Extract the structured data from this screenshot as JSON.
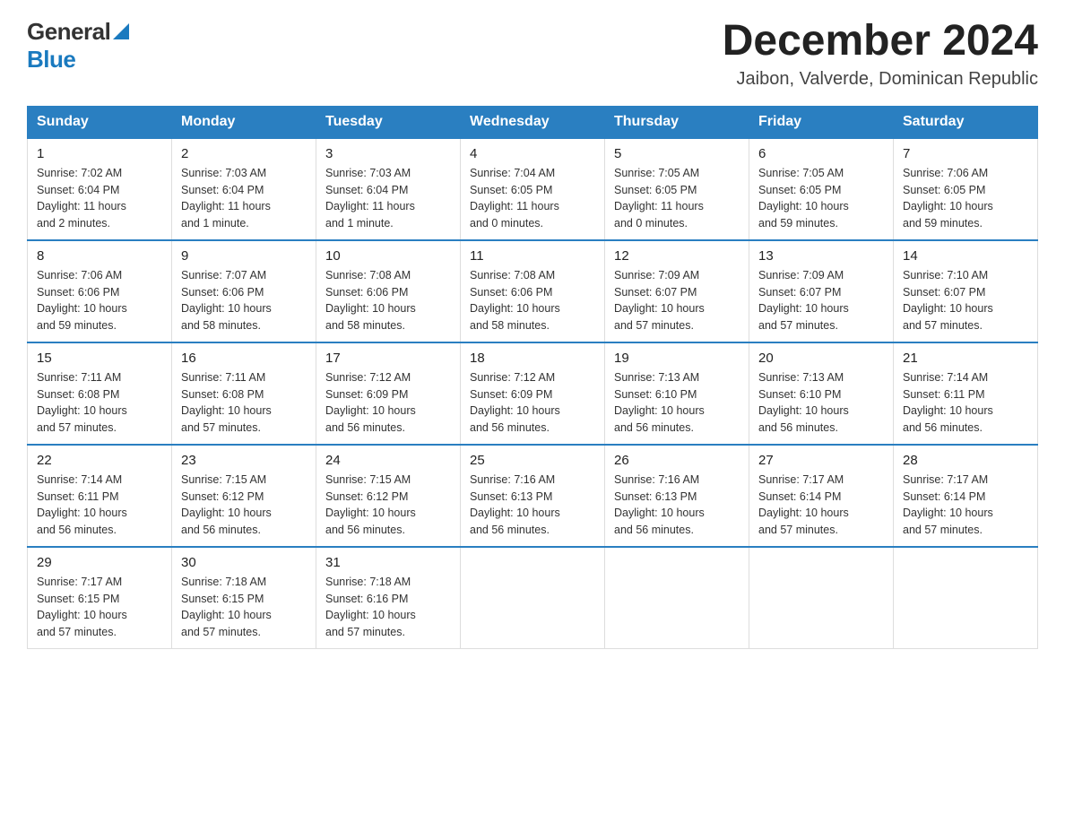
{
  "header": {
    "logo_general": "General",
    "logo_blue": "Blue",
    "title": "December 2024",
    "subtitle": "Jaibon, Valverde, Dominican Republic"
  },
  "days_of_week": [
    "Sunday",
    "Monday",
    "Tuesday",
    "Wednesday",
    "Thursday",
    "Friday",
    "Saturday"
  ],
  "weeks": [
    [
      {
        "num": "1",
        "sunrise": "7:02 AM",
        "sunset": "6:04 PM",
        "daylight": "11 hours and 2 minutes."
      },
      {
        "num": "2",
        "sunrise": "7:03 AM",
        "sunset": "6:04 PM",
        "daylight": "11 hours and 1 minute."
      },
      {
        "num": "3",
        "sunrise": "7:03 AM",
        "sunset": "6:04 PM",
        "daylight": "11 hours and 1 minute."
      },
      {
        "num": "4",
        "sunrise": "7:04 AM",
        "sunset": "6:05 PM",
        "daylight": "11 hours and 0 minutes."
      },
      {
        "num": "5",
        "sunrise": "7:05 AM",
        "sunset": "6:05 PM",
        "daylight": "11 hours and 0 minutes."
      },
      {
        "num": "6",
        "sunrise": "7:05 AM",
        "sunset": "6:05 PM",
        "daylight": "10 hours and 59 minutes."
      },
      {
        "num": "7",
        "sunrise": "7:06 AM",
        "sunset": "6:05 PM",
        "daylight": "10 hours and 59 minutes."
      }
    ],
    [
      {
        "num": "8",
        "sunrise": "7:06 AM",
        "sunset": "6:06 PM",
        "daylight": "10 hours and 59 minutes."
      },
      {
        "num": "9",
        "sunrise": "7:07 AM",
        "sunset": "6:06 PM",
        "daylight": "10 hours and 58 minutes."
      },
      {
        "num": "10",
        "sunrise": "7:08 AM",
        "sunset": "6:06 PM",
        "daylight": "10 hours and 58 minutes."
      },
      {
        "num": "11",
        "sunrise": "7:08 AM",
        "sunset": "6:06 PM",
        "daylight": "10 hours and 58 minutes."
      },
      {
        "num": "12",
        "sunrise": "7:09 AM",
        "sunset": "6:07 PM",
        "daylight": "10 hours and 57 minutes."
      },
      {
        "num": "13",
        "sunrise": "7:09 AM",
        "sunset": "6:07 PM",
        "daylight": "10 hours and 57 minutes."
      },
      {
        "num": "14",
        "sunrise": "7:10 AM",
        "sunset": "6:07 PM",
        "daylight": "10 hours and 57 minutes."
      }
    ],
    [
      {
        "num": "15",
        "sunrise": "7:11 AM",
        "sunset": "6:08 PM",
        "daylight": "10 hours and 57 minutes."
      },
      {
        "num": "16",
        "sunrise": "7:11 AM",
        "sunset": "6:08 PM",
        "daylight": "10 hours and 57 minutes."
      },
      {
        "num": "17",
        "sunrise": "7:12 AM",
        "sunset": "6:09 PM",
        "daylight": "10 hours and 56 minutes."
      },
      {
        "num": "18",
        "sunrise": "7:12 AM",
        "sunset": "6:09 PM",
        "daylight": "10 hours and 56 minutes."
      },
      {
        "num": "19",
        "sunrise": "7:13 AM",
        "sunset": "6:10 PM",
        "daylight": "10 hours and 56 minutes."
      },
      {
        "num": "20",
        "sunrise": "7:13 AM",
        "sunset": "6:10 PM",
        "daylight": "10 hours and 56 minutes."
      },
      {
        "num": "21",
        "sunrise": "7:14 AM",
        "sunset": "6:11 PM",
        "daylight": "10 hours and 56 minutes."
      }
    ],
    [
      {
        "num": "22",
        "sunrise": "7:14 AM",
        "sunset": "6:11 PM",
        "daylight": "10 hours and 56 minutes."
      },
      {
        "num": "23",
        "sunrise": "7:15 AM",
        "sunset": "6:12 PM",
        "daylight": "10 hours and 56 minutes."
      },
      {
        "num": "24",
        "sunrise": "7:15 AM",
        "sunset": "6:12 PM",
        "daylight": "10 hours and 56 minutes."
      },
      {
        "num": "25",
        "sunrise": "7:16 AM",
        "sunset": "6:13 PM",
        "daylight": "10 hours and 56 minutes."
      },
      {
        "num": "26",
        "sunrise": "7:16 AM",
        "sunset": "6:13 PM",
        "daylight": "10 hours and 56 minutes."
      },
      {
        "num": "27",
        "sunrise": "7:17 AM",
        "sunset": "6:14 PM",
        "daylight": "10 hours and 57 minutes."
      },
      {
        "num": "28",
        "sunrise": "7:17 AM",
        "sunset": "6:14 PM",
        "daylight": "10 hours and 57 minutes."
      }
    ],
    [
      {
        "num": "29",
        "sunrise": "7:17 AM",
        "sunset": "6:15 PM",
        "daylight": "10 hours and 57 minutes."
      },
      {
        "num": "30",
        "sunrise": "7:18 AM",
        "sunset": "6:15 PM",
        "daylight": "10 hours and 57 minutes."
      },
      {
        "num": "31",
        "sunrise": "7:18 AM",
        "sunset": "6:16 PM",
        "daylight": "10 hours and 57 minutes."
      },
      null,
      null,
      null,
      null
    ]
  ],
  "labels": {
    "sunrise": "Sunrise:",
    "sunset": "Sunset:",
    "daylight": "Daylight:"
  }
}
